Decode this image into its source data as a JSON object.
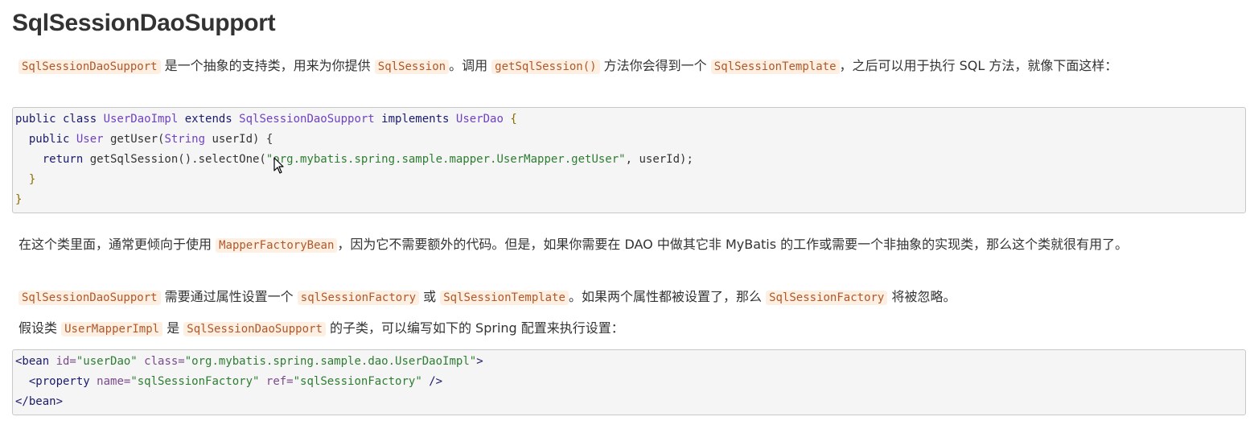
{
  "title": "SqlSessionDaoSupport",
  "p1": {
    "code1": "SqlSessionDaoSupport",
    "text1": " 是一个抽象的支持类，用来为你提供 ",
    "code2": "SqlSession",
    "text2": "。调用 ",
    "code3": "getSqlSession()",
    "text3": " 方法你会得到一个 ",
    "code4": "SqlSessionTemplate",
    "text4": "，之后可以用于执行 SQL 方法，就像下面这样："
  },
  "code_block_1": {
    "line1": {
      "a": "public class ",
      "b": "UserDaoImpl",
      "c": " extends ",
      "d": "SqlSessionDaoSupport",
      "e": " implements ",
      "f": "UserDao",
      "g": " {"
    },
    "line2": {
      "a": "  public ",
      "b": "User",
      "c": " getUser(",
      "d": "String",
      "e": " userId) {"
    },
    "line3": {
      "a": "    return ",
      "b": "getSqlSession().selectOne(",
      "c": "\"org.mybatis.spring.sample.mapper.UserMapper.getUser\"",
      "d": ", userId);"
    },
    "line4": "  }",
    "line5": "}"
  },
  "p2": {
    "text1": "在这个类里面，通常更倾向于使用 ",
    "code1": "MapperFactoryBean",
    "text2": "，因为它不需要额外的代码。但是，如果你需要在 DAO 中做其它非 MyBatis 的工作或需要一个非抽象的实现类，那么这个类就很有用了。"
  },
  "p3": {
    "code1": "SqlSessionDaoSupport",
    "text1": " 需要通过属性设置一个 ",
    "code2": "sqlSessionFactory",
    "text2": " 或 ",
    "code3": "SqlSessionTemplate",
    "text3": "。如果两个属性都被设置了，那么 ",
    "code4": "SqlSessionFactory",
    "text4": " 将被忽略。"
  },
  "p4": {
    "text1": "假设类 ",
    "code1": "UserMapperImpl",
    "text2": " 是 ",
    "code2": "SqlSessionDaoSupport",
    "text3": " 的子类，可以编写如下的 Spring 配置来执行设置："
  },
  "code_block_2": {
    "line1": {
      "a": "<bean ",
      "b": "id=",
      "c": "\"userDao\"",
      "d": " class=",
      "e": "\"org.mybatis.spring.sample.dao.UserDaoImpl\"",
      "f": ">"
    },
    "line2": {
      "a": "  <property ",
      "b": "name=",
      "c": "\"sqlSessionFactory\"",
      "d": " ref=",
      "e": "\"sqlSessionFactory\"",
      "f": " />"
    },
    "line3": "</bean>"
  },
  "icons": {
    "cursor": "mouse-pointer-icon"
  }
}
